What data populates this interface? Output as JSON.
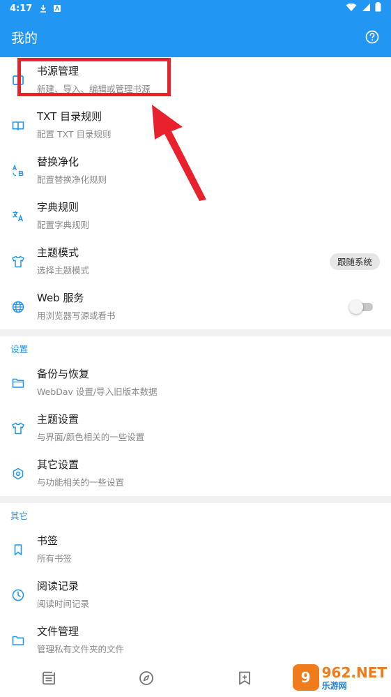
{
  "status_bar": {
    "time": "4:17"
  },
  "app_bar": {
    "title": "我的"
  },
  "main_items": [
    {
      "title": "书源管理",
      "subtitle": "新建、导入、编辑或管理书源"
    },
    {
      "title": "TXT 目录规则",
      "subtitle": "配置 TXT 目录规则"
    },
    {
      "title": "替换净化",
      "subtitle": "配置替换净化规则"
    },
    {
      "title": "字典规则",
      "subtitle": "配置字典规则"
    },
    {
      "title": "主题模式",
      "subtitle": "选择主题模式",
      "chip": "跟随系统"
    },
    {
      "title": "Web 服务",
      "subtitle": "用浏览器写源或看书",
      "toggle_on": false
    }
  ],
  "settings_section": {
    "header": "设置",
    "items": [
      {
        "title": "备份与恢复",
        "subtitle": "WebDav 设置/导入旧版本数据"
      },
      {
        "title": "主题设置",
        "subtitle": "与界面/颜色相关的一些设置"
      },
      {
        "title": "其它设置",
        "subtitle": "与功能相关的一些设置"
      }
    ]
  },
  "other_section": {
    "header": "其它",
    "items": [
      {
        "title": "书签",
        "subtitle": "所有书签"
      },
      {
        "title": "阅读记录",
        "subtitle": "阅读时间记录"
      },
      {
        "title": "文件管理",
        "subtitle": "管理私有文件夹的文件"
      }
    ]
  },
  "watermark": {
    "brand": "962.NET",
    "box": "9",
    "sub": "乐游网"
  },
  "colors": {
    "primary": "#2196f3",
    "annotation": "#e8212c",
    "watermark": "#f07b1a"
  }
}
